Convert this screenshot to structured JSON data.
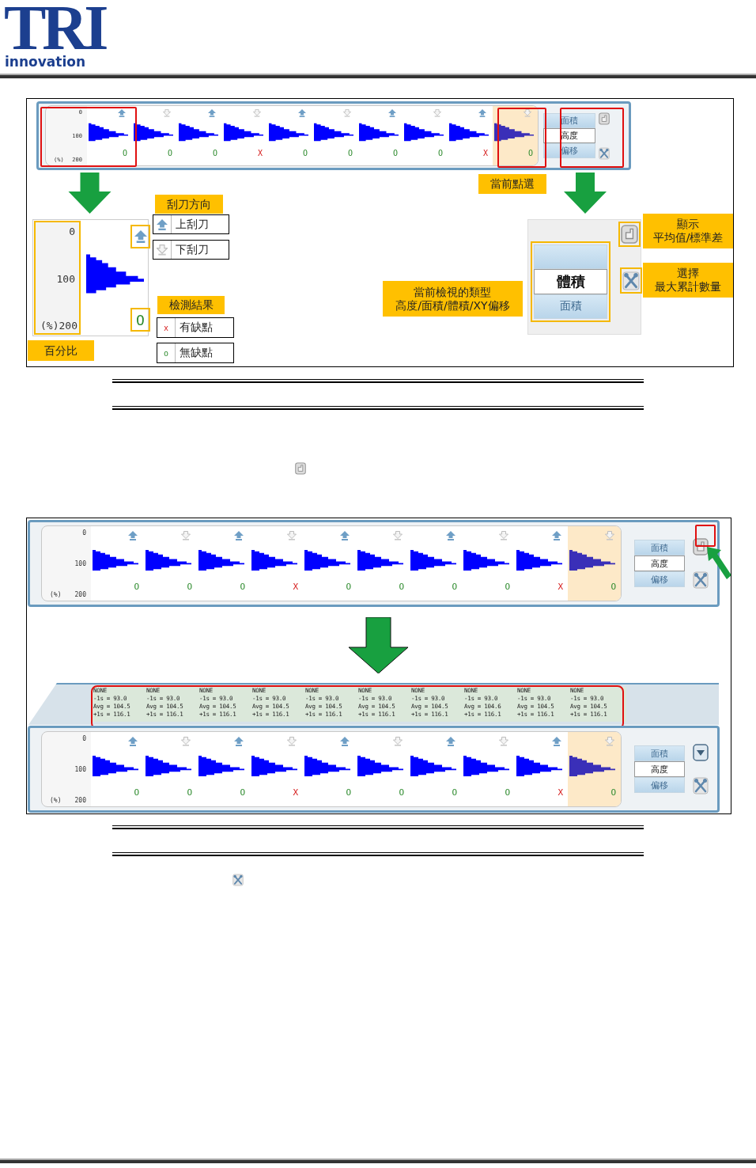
{
  "header": {
    "logo": "TRI",
    "tagline": "innovation"
  },
  "figure_1": {
    "strip": {
      "axis": [
        "0",
        "100",
        "(%)",
        "200"
      ],
      "cells": [
        {
          "kind": "up",
          "result": "O",
          "defect": false,
          "selected": false
        },
        {
          "kind": "down",
          "result": "O",
          "defect": false,
          "selected": false
        },
        {
          "kind": "up",
          "result": "O",
          "defect": false,
          "selected": false
        },
        {
          "kind": "down",
          "result": "X",
          "defect": true,
          "selected": false
        },
        {
          "kind": "up",
          "result": "O",
          "defect": false,
          "selected": false
        },
        {
          "kind": "down",
          "result": "O",
          "defect": false,
          "selected": false
        },
        {
          "kind": "up",
          "result": "O",
          "defect": false,
          "selected": false
        },
        {
          "kind": "down",
          "result": "O",
          "defect": false,
          "selected": false
        },
        {
          "kind": "up",
          "result": "X",
          "defect": true,
          "selected": false
        },
        {
          "kind": "down",
          "result": "O",
          "defect": false,
          "selected": true
        }
      ],
      "selector": [
        {
          "label": "面積",
          "selected": false
        },
        {
          "label": "高度",
          "selected": true
        },
        {
          "label": "偏移",
          "selected": false
        }
      ],
      "toggle": {
        "kind": "stats"
      }
    },
    "current_callout": "當前點選",
    "detail": {
      "axis": [
        "0",
        "100",
        "(%)",
        "200"
      ],
      "kind": "up",
      "result": "O",
      "defect": false
    },
    "direction_legend": {
      "title": "刮刀方向",
      "items": [
        {
          "kind": "up",
          "label": "上刮刀"
        },
        {
          "kind": "down",
          "label": "下刮刀"
        }
      ]
    },
    "result_legend": {
      "title": "檢測結果",
      "items": [
        {
          "result": "x",
          "defect": true,
          "label": "有缺點"
        },
        {
          "result": "o",
          "defect": false,
          "label": "無缺點"
        }
      ]
    },
    "percent_callout": "百分比",
    "type_callout": [
      "當前檢視的類型",
      "高度/面積/體積/XY偏移"
    ],
    "type_selector": [
      {
        "label": "體積",
        "selected": true
      },
      {
        "label": "面積",
        "selected": false
      }
    ],
    "stats_callout": [
      "顯示",
      "平均值/標準差"
    ],
    "tools_callout": [
      "選擇",
      "最大累計數量"
    ]
  },
  "figure_2": {
    "strip_before": {
      "axis": [
        "0",
        "100",
        "(%)",
        "200"
      ],
      "cells": [
        {
          "kind": "up",
          "result": "O",
          "defect": false,
          "selected": false
        },
        {
          "kind": "down",
          "result": "O",
          "defect": false,
          "selected": false
        },
        {
          "kind": "up",
          "result": "O",
          "defect": false,
          "selected": false
        },
        {
          "kind": "down",
          "result": "X",
          "defect": true,
          "selected": false
        },
        {
          "kind": "up",
          "result": "O",
          "defect": false,
          "selected": false
        },
        {
          "kind": "down",
          "result": "O",
          "defect": false,
          "selected": false
        },
        {
          "kind": "up",
          "result": "O",
          "defect": false,
          "selected": false
        },
        {
          "kind": "down",
          "result": "O",
          "defect": false,
          "selected": false
        },
        {
          "kind": "up",
          "result": "X",
          "defect": true,
          "selected": false
        },
        {
          "kind": "down",
          "result": "O",
          "defect": false,
          "selected": true
        }
      ],
      "selector": [
        {
          "label": "面積",
          "selected": false
        },
        {
          "label": "高度",
          "selected": true
        },
        {
          "label": "偏移",
          "selected": false
        }
      ],
      "toggle": {
        "kind": "stats"
      }
    },
    "stats": [
      {
        "lines": [
          "NONE",
          "-1s = 93.0",
          "Avg = 104.5",
          "+1s = 116.1"
        ]
      },
      {
        "lines": [
          "NONE",
          "-1s = 93.0",
          "Avg = 104.5",
          "+1s = 116.1"
        ]
      },
      {
        "lines": [
          "NONE",
          "-1s = 93.0",
          "Avg = 104.5",
          "+1s = 116.1"
        ]
      },
      {
        "lines": [
          "NONE",
          "-1s = 93.0",
          "Avg = 104.5",
          "+1s = 116.1"
        ]
      },
      {
        "lines": [
          "NONE",
          "-1s = 93.0",
          "Avg = 104.5",
          "+1s = 116.1"
        ]
      },
      {
        "lines": [
          "NONE",
          "-1s = 93.0",
          "Avg = 104.5",
          "+1s = 116.1"
        ]
      },
      {
        "lines": [
          "NONE",
          "-1s = 93.0",
          "Avg = 104.5",
          "+1s = 116.1"
        ]
      },
      {
        "lines": [
          "NONE",
          "-1s = 93.0",
          "Avg = 104.6",
          "+1s = 116.1"
        ]
      },
      {
        "lines": [
          "NONE",
          "-1s = 93.0",
          "Avg = 104.5",
          "+1s = 116.1"
        ]
      },
      {
        "lines": [
          "NONE",
          "-1s = 93.0",
          "Avg = 104.5",
          "+1s = 116.1"
        ]
      }
    ],
    "strip_after": {
      "axis": [
        "0",
        "100",
        "(%)",
        "200"
      ],
      "cells": [
        {
          "kind": "up",
          "result": "O",
          "defect": false,
          "selected": false
        },
        {
          "kind": "down",
          "result": "O",
          "defect": false,
          "selected": false
        },
        {
          "kind": "up",
          "result": "O",
          "defect": false,
          "selected": false
        },
        {
          "kind": "down",
          "result": "X",
          "defect": true,
          "selected": false
        },
        {
          "kind": "up",
          "result": "O",
          "defect": false,
          "selected": false
        },
        {
          "kind": "down",
          "result": "O",
          "defect": false,
          "selected": false
        },
        {
          "kind": "up",
          "result": "O",
          "defect": false,
          "selected": false
        },
        {
          "kind": "down",
          "result": "O",
          "defect": false,
          "selected": false
        },
        {
          "kind": "up",
          "result": "X",
          "defect": true,
          "selected": false
        },
        {
          "kind": "down",
          "result": "O",
          "defect": false,
          "selected": true
        }
      ],
      "selector": [
        {
          "label": "面積",
          "selected": false
        },
        {
          "label": "高度",
          "selected": true
        },
        {
          "label": "偏移",
          "selected": false
        }
      ],
      "toggle": {
        "kind": "collapse"
      }
    }
  }
}
